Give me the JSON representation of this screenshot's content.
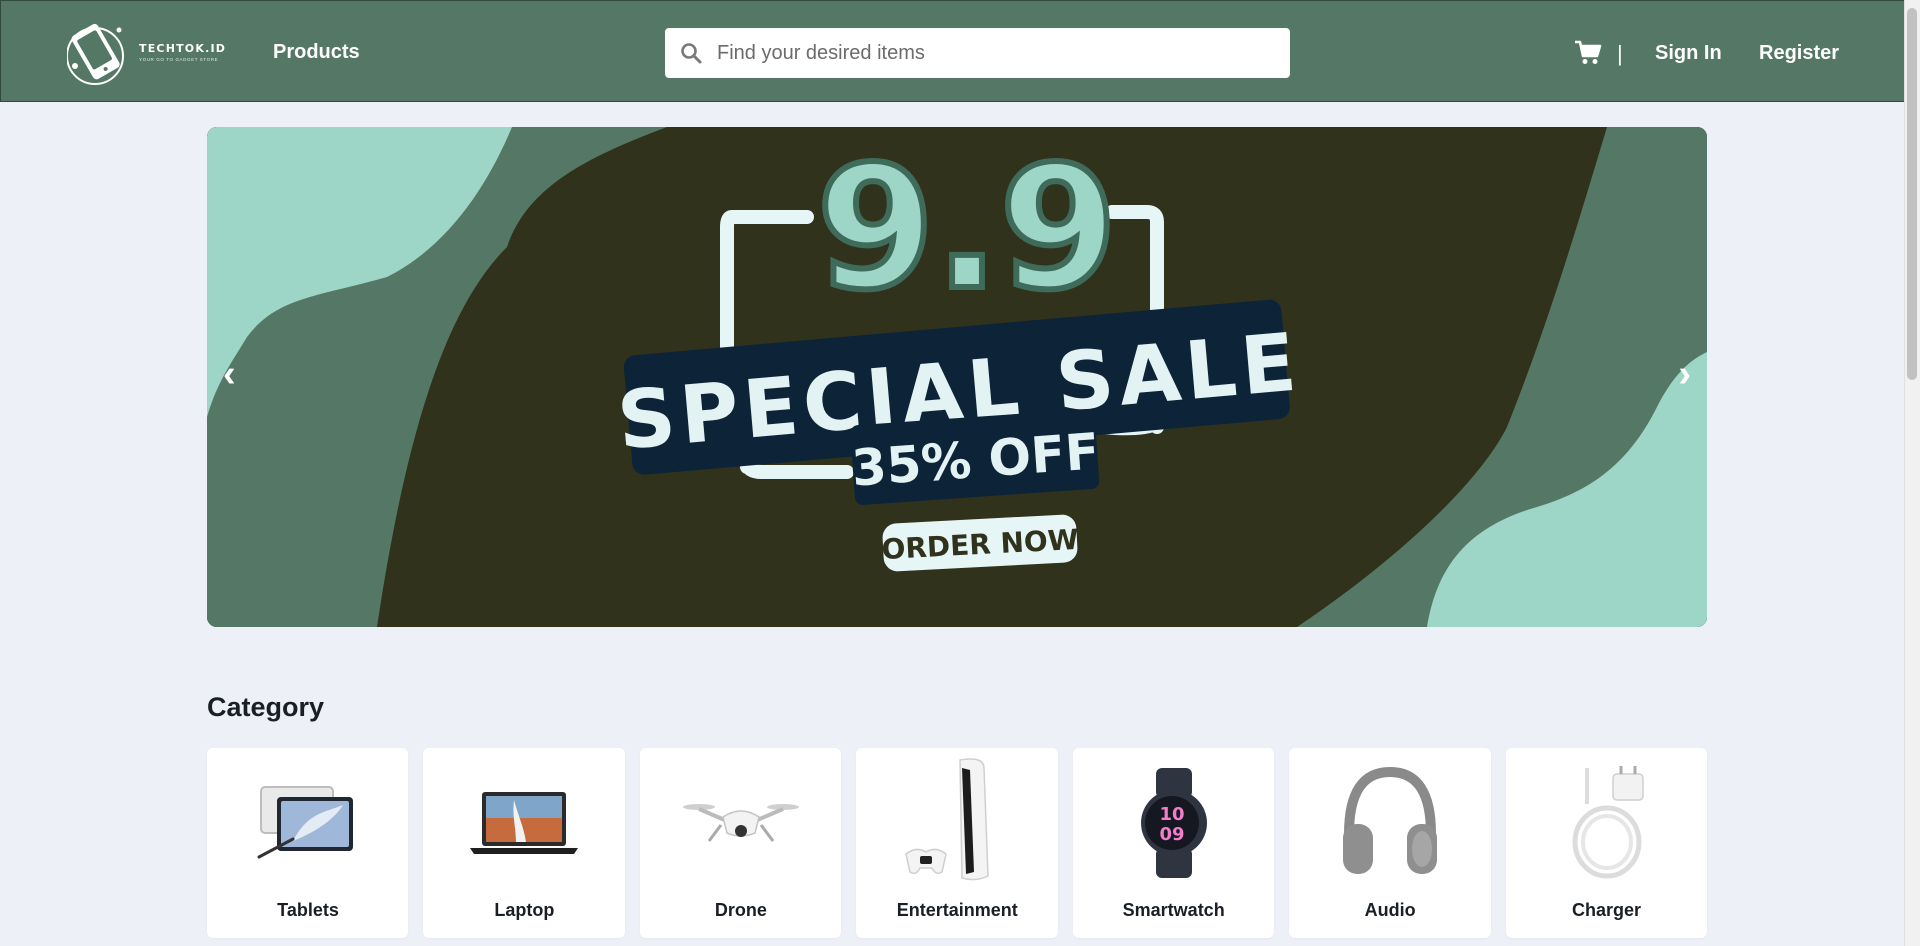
{
  "header": {
    "logo_name": "TECHTOK.ID",
    "logo_tagline": "YOUR GO TO GADGET STORE",
    "nav_products": "Products",
    "search_placeholder": "Find your desired items",
    "divider": "|",
    "sign_in": "Sign In",
    "register": "Register",
    "icons": [
      "search-icon",
      "cart-icon"
    ]
  },
  "banner": {
    "headline": "9.9",
    "title": "SPECIAL SALE",
    "discount": "35% OFF",
    "cta": "ORDER NOW",
    "prev": "‹",
    "next": "›"
  },
  "category": {
    "title": "Category",
    "items": [
      {
        "label": "Tablets"
      },
      {
        "label": "Laptop"
      },
      {
        "label": "Drone"
      },
      {
        "label": "Entertainment"
      },
      {
        "label": "Smartwatch"
      },
      {
        "label": "Audio"
      },
      {
        "label": "Charger"
      }
    ]
  },
  "colors": {
    "header_bg": "#557866",
    "page_bg": "#edf1f7",
    "banner_dark": "#30321c",
    "banner_mint": "#9dd5c7",
    "banner_green": "#557866",
    "badge_navy": "#0d2438"
  }
}
